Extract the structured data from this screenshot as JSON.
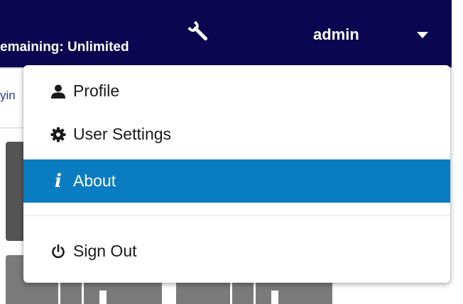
{
  "topbar": {
    "remaining_text": "emaining: Unlimited",
    "user_name": "admin",
    "tools_icon": "wrench-icon",
    "dropdown_icon": "caret-down-icon",
    "background_color": "#0a0650"
  },
  "background": {
    "link_fragment": "yin"
  },
  "user_menu": {
    "items": [
      {
        "label": "Profile",
        "icon": "user-icon"
      },
      {
        "label": "User Settings",
        "icon": "gear-icon"
      },
      {
        "label": "About",
        "icon": "info-icon",
        "highlighted": true
      },
      {
        "label": "Sign Out",
        "icon": "power-icon"
      }
    ],
    "highlight_color": "#0a7cc1"
  }
}
